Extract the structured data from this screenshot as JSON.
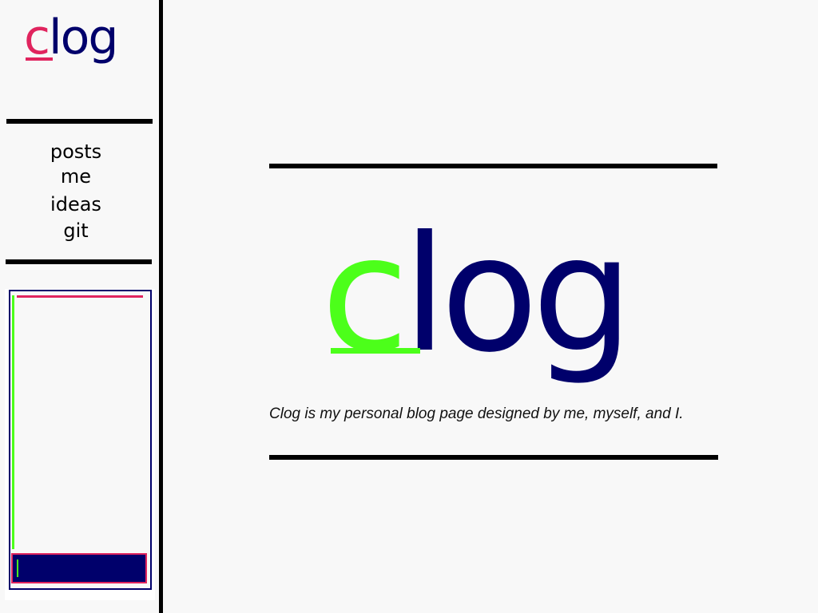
{
  "sidebar": {
    "logo": {
      "first_letter": "c",
      "rest": "log"
    },
    "nav": [
      {
        "label": "posts"
      },
      {
        "label": "me"
      },
      {
        "label": "ideas"
      },
      {
        "label": "git"
      }
    ],
    "widget": {
      "input_value": ""
    }
  },
  "main": {
    "hero_logo": {
      "first_letter": "c",
      "rest": "log"
    },
    "tagline": "Clog is my personal blog page designed by me, myself, and I."
  },
  "colors": {
    "background": "#f8f8f8",
    "navy": "#00006b",
    "pink_accent": "#e0245e",
    "green_accent": "#4cff1a",
    "rule": "#000000"
  }
}
